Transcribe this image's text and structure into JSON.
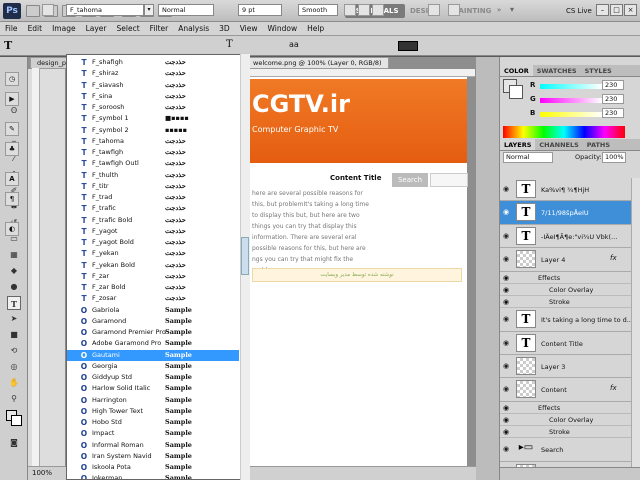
{
  "app": {
    "logo": "Ps"
  },
  "workspaces": [
    "ESSENTIALS",
    "DESIGN",
    "PAINTING"
  ],
  "cs_live": "CS Live",
  "menus": [
    "File",
    "Edit",
    "Image",
    "Layer",
    "Select",
    "Filter",
    "Analysis",
    "3D",
    "View",
    "Window",
    "Help"
  ],
  "options": {
    "font_family": "F_tahoma",
    "font_style": "Normal",
    "font_size": "9 pt",
    "anti_alias": "Smooth"
  },
  "doc": {
    "tab_left": "design_ps",
    "tab_main": "welcome.png @ 100% (Layer 0, RGB/8)",
    "zoom": "100%"
  },
  "page": {
    "logo": "CGTV.ir",
    "subtitle": "Computer Graphic TV",
    "content_title": "Content Title",
    "search": "Search",
    "body": "here are several possible reasons for this, but problemIt's taking a long time to display this but, but here are two things you can try that display this information. There are several eral possible reasons for this, but here are ngs you can try that might fix the problem",
    "note": "نوشته شده توسط مدیر وبسایت"
  },
  "font_list": [
    {
      "icon": "T",
      "name": "F_shafigh",
      "sample": "حذدجت"
    },
    {
      "icon": "T",
      "name": "F_shiraz",
      "sample": "حذدجت"
    },
    {
      "icon": "T",
      "name": "F_siavash",
      "sample": "حذدجت"
    },
    {
      "icon": "T",
      "name": "F_sina",
      "sample": "حذدجت"
    },
    {
      "icon": "T",
      "name": "F_soroosh",
      "sample": "حذدجت"
    },
    {
      "icon": "T",
      "name": "F_symbol 1",
      "sample": "■▪▪▪▪"
    },
    {
      "icon": "T",
      "name": "F_symbol 2",
      "sample": "▪▪▪▪▪"
    },
    {
      "icon": "T",
      "name": "F_tahoma",
      "sample": "حذدجت"
    },
    {
      "icon": "T",
      "name": "F_tawfigh",
      "sample": "حذدجت"
    },
    {
      "icon": "T",
      "name": "F_tawfigh Outl",
      "sample": "حذدجت"
    },
    {
      "icon": "T",
      "name": "F_thulth",
      "sample": "حذدجت"
    },
    {
      "icon": "T",
      "name": "F_titr",
      "sample": "حذدجت"
    },
    {
      "icon": "T",
      "name": "F_trad",
      "sample": "حذدجت"
    },
    {
      "icon": "T",
      "name": "F_trafic",
      "sample": "حذدجت"
    },
    {
      "icon": "T",
      "name": "F_trafic Bold",
      "sample": "حذدجت"
    },
    {
      "icon": "T",
      "name": "F_yagot",
      "sample": "حذدجت"
    },
    {
      "icon": "T",
      "name": "F_yagot Bold",
      "sample": "حذدجت"
    },
    {
      "icon": "T",
      "name": "F_yekan",
      "sample": "حذدجت"
    },
    {
      "icon": "T",
      "name": "F_yekan Bold",
      "sample": "حذدجت"
    },
    {
      "icon": "T",
      "name": "F_zar",
      "sample": "حذدجت"
    },
    {
      "icon": "T",
      "name": "F_zar Bold",
      "sample": "حذدجت"
    },
    {
      "icon": "T",
      "name": "F_zosar",
      "sample": "حذدجت"
    },
    {
      "icon": "O",
      "name": "Gabriola",
      "sample": "Sample"
    },
    {
      "icon": "O",
      "name": "Garamond",
      "sample": "Sample"
    },
    {
      "icon": "O",
      "name": "Garamond Premier Pro",
      "sample": "Sample"
    },
    {
      "icon": "O",
      "name": "Adobe Garamond Pro",
      "sample": "Sample"
    },
    {
      "icon": "O",
      "name": "Gautami",
      "sample": "Sample"
    },
    {
      "icon": "O",
      "name": "Georgia",
      "sample": "Sample"
    },
    {
      "icon": "O",
      "name": "Giddyup Std",
      "sample": "Sample"
    },
    {
      "icon": "O",
      "name": "Harlow Solid Italic",
      "sample": "Sample"
    },
    {
      "icon": "O",
      "name": "Harrington",
      "sample": "Sample"
    },
    {
      "icon": "O",
      "name": "High Tower Text",
      "sample": "Sample"
    },
    {
      "icon": "O",
      "name": "Hobo Std",
      "sample": "Sample"
    },
    {
      "icon": "O",
      "name": "Impact",
      "sample": "Sample"
    },
    {
      "icon": "O",
      "name": "Informal Roman",
      "sample": "Sample"
    },
    {
      "icon": "O",
      "name": "Iran System Navid",
      "sample": "Sample"
    },
    {
      "icon": "O",
      "name": "Iskoola Pota",
      "sample": "Sample"
    },
    {
      "icon": "O",
      "name": "Jokerman",
      "sample": "Sample"
    }
  ],
  "font_selected": 26,
  "color_panel": {
    "tabs": [
      "COLOR",
      "SWATCHES",
      "STYLES"
    ],
    "r": "230",
    "g": "230",
    "b": "230"
  },
  "layers_panel": {
    "tabs": [
      "LAYERS",
      "CHANNELS",
      "PATHS"
    ],
    "blend": "Normal",
    "opacity_label": "Opacity:",
    "opacity": "100%"
  },
  "layers": [
    {
      "kind": "text",
      "name": "Ka%vi¶ ¾¶HjH",
      "fx": false,
      "sel": false
    },
    {
      "kind": "text",
      "name": "7/11/98špÅeIU",
      "fx": false,
      "sel": true
    },
    {
      "kind": "text",
      "name": "-IÄeI¶Ã¶e:\"vi¾U Vbk(...",
      "fx": false,
      "sel": false
    },
    {
      "kind": "img",
      "name": "Layer 4",
      "fx": true,
      "sel": false
    },
    {
      "kind": "sub",
      "name": "Effects"
    },
    {
      "kind": "sub2",
      "name": "Color Overlay"
    },
    {
      "kind": "sub2",
      "name": "Stroke"
    },
    {
      "kind": "text",
      "name": "It's taking a long time to d...",
      "fx": false,
      "sel": false
    },
    {
      "kind": "text",
      "name": "Content Title",
      "fx": false,
      "sel": false
    },
    {
      "kind": "img",
      "name": "Layer 3",
      "fx": false,
      "sel": false
    },
    {
      "kind": "img",
      "name": "Content",
      "fx": true,
      "sel": false
    },
    {
      "kind": "sub",
      "name": "Effects"
    },
    {
      "kind": "sub2",
      "name": "Color Overlay"
    },
    {
      "kind": "sub2",
      "name": "Stroke"
    },
    {
      "kind": "group",
      "name": "Search",
      "fx": false,
      "sel": false
    },
    {
      "kind": "img",
      "name": "right menu",
      "fx": true,
      "sel": false
    }
  ],
  "colors": {
    "accent": "#3399ff",
    "banner": "#e8671a"
  }
}
